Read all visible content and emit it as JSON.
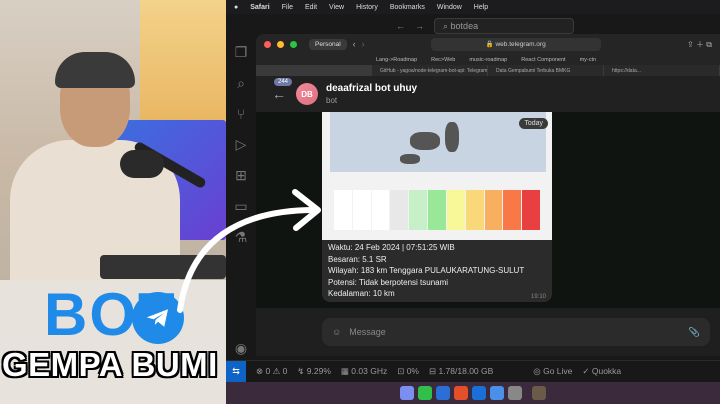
{
  "menubar": {
    "apple": "",
    "app": "Safari",
    "items": [
      "File",
      "Edit",
      "View",
      "History",
      "Bookmarks",
      "Window",
      "Help"
    ]
  },
  "vscode": {
    "search": "botdea"
  },
  "browser": {
    "profile": "Personal",
    "url": "web.telegram.org",
    "bookmarks": [
      "Lang->Roadmap",
      "Rec>Web",
      "music-roadmap",
      "React Component",
      "my-ctn"
    ],
    "tabs": [
      "GitHub - yagoa/node-telegram-bot-api: Telegram Bot...",
      "Data Gempabumi Terbuka BMKG",
      "https://data..."
    ]
  },
  "telegram": {
    "unread": "244",
    "avatar_initials": "DB",
    "chat_name": "deaafrizal bot uhuy",
    "chat_status": "bot",
    "today_label": "Today",
    "message_lines": [
      "Waktu: 24 Feb 2024 | 07:51:25 WIB",
      "Besaran: 5.1 SR",
      "Wilayah: 183 km Tenggara PULAUKARATUNG-SULUT",
      "Potensi: Tidak berpotensi tsunami",
      "Kedalaman: 10 km"
    ],
    "message_time": "19:10",
    "composer_placeholder": "Message"
  },
  "statusbar": {
    "errors": "0",
    "warnings": "0",
    "cpu": "9.29%",
    "freq": "0.03 GHz",
    "temp": "0%",
    "mem": "1.78/18.00 GB",
    "go_live": "Go Live",
    "quokka": "Quokka"
  },
  "overlay": {
    "bot_text": "BOT",
    "title_text": "GEMPA BUMI"
  },
  "colors": {
    "accent": "#1f8ae8",
    "telegram_avatar": "#e06f7e"
  }
}
